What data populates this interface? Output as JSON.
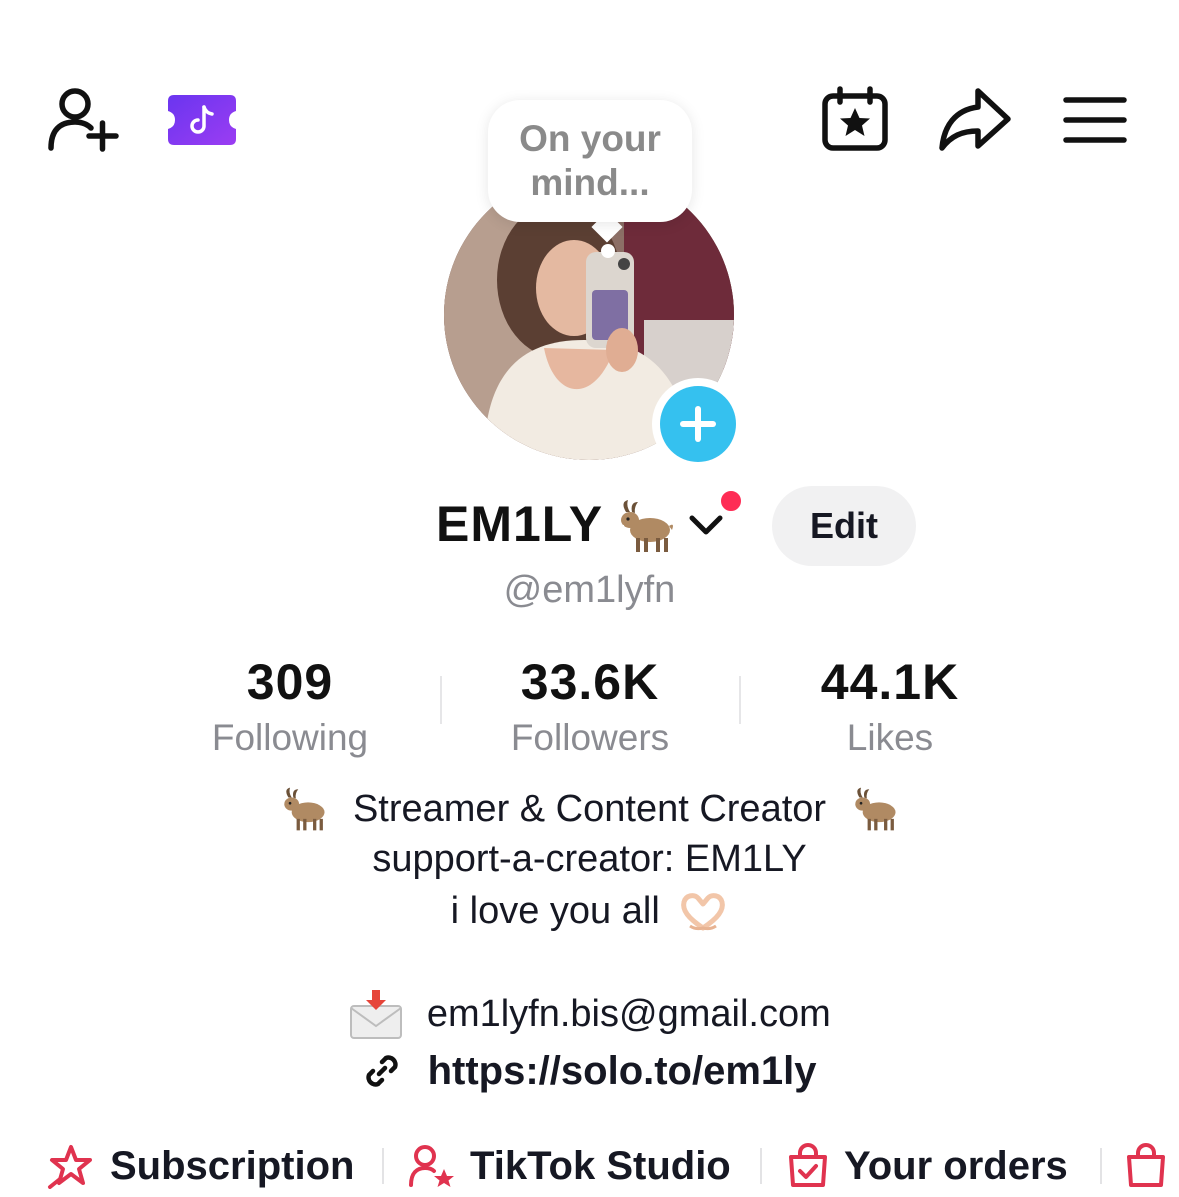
{
  "header": {
    "add_friend_icon": "person-add-icon",
    "promo_icon": "tiktok-ticket-icon",
    "calendar_icon": "calendar-star-icon",
    "share_icon": "share-arrow-icon",
    "menu_icon": "hamburger-menu-icon"
  },
  "avatar": {
    "note_prompt": "On your mind...",
    "add_icon": "plus-icon",
    "add_color": "#35c1ef"
  },
  "profile": {
    "display_name": "EM1LY",
    "name_emoji": "🐐",
    "edit_label": "Edit",
    "username": "@em1lyfn",
    "notification_dot_color": "#fe2c55"
  },
  "stats": {
    "following_count": "309",
    "following_label": "Following",
    "followers_count": "33.6K",
    "followers_label": "Followers",
    "likes_count": "44.1K",
    "likes_label": "Likes"
  },
  "bio": {
    "line1": "Streamer & Content Creator",
    "line2": "support-a-creator: EM1LY",
    "line3": "i love you all",
    "email": "em1lyfn.bis@gmail.com",
    "link": "https://solo.to/em1ly"
  },
  "shortcuts": {
    "subscription_label": "Subscription",
    "studio_label": "TikTok Studio",
    "orders_label": "Your orders",
    "accent_color": "#e0334f"
  }
}
